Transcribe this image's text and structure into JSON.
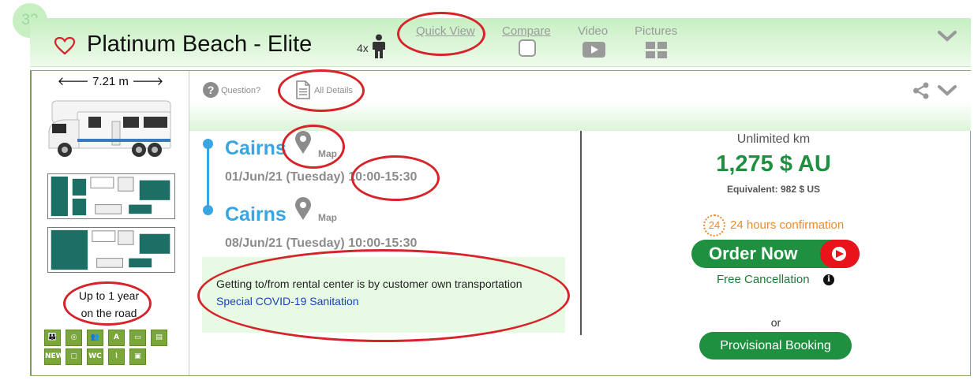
{
  "listing": {
    "index": "32",
    "title": "Platinum Beach - Elite",
    "occupancy": "4x"
  },
  "header_tabs": {
    "quick_view": "Quick View",
    "compare": "Compare",
    "video": "Video",
    "pictures": "Pictures"
  },
  "vehicle": {
    "length": "7.21 m",
    "road_note_line1": "Up to 1 year",
    "road_note_line2": "on the road",
    "features": [
      "NEW",
      "WC"
    ]
  },
  "toolbar": {
    "question": "Question?",
    "all_details": "All Details"
  },
  "trip": {
    "pickup": {
      "city": "Cairns",
      "map_label": "Map",
      "date": "01/Jun/21 (Tuesday)",
      "time": "10:00-15:30"
    },
    "dropoff": {
      "city": "Cairns",
      "map_label": "Map",
      "datetime": "08/Jun/21 (Tuesday) 10:00-15:30"
    },
    "info_line1": "Getting to/from rental center is by customer own transportation",
    "info_link": "Special COVID-19 Sanitation"
  },
  "pricing": {
    "km": "Unlimited km",
    "price": "1,275 $ AU",
    "equivalent": "Equivalent: 982 $ US",
    "confirmation_hours": "24",
    "confirmation_text": "24 hours confirmation",
    "order_label": "Order Now",
    "free_cancellation": "Free Cancellation",
    "info_glyph": "i",
    "or": "or",
    "provisional_label": "Provisional Booking"
  },
  "colors": {
    "header_green": "#c6efc2",
    "price_green": "#1e9040",
    "location_blue": "#3aa5e0",
    "order_arrow_red": "#e8141a",
    "confirmation_orange": "#ef8a2c",
    "annotation_red": "#d6242b"
  },
  "icons": [
    "heart-icon",
    "person-icon",
    "checkbox-icon",
    "video-icon",
    "pictures-icon",
    "chevron-down-icon",
    "question-icon",
    "document-icon",
    "share-icon",
    "map-pin-icon",
    "arrow-right-icon",
    "info-icon"
  ]
}
